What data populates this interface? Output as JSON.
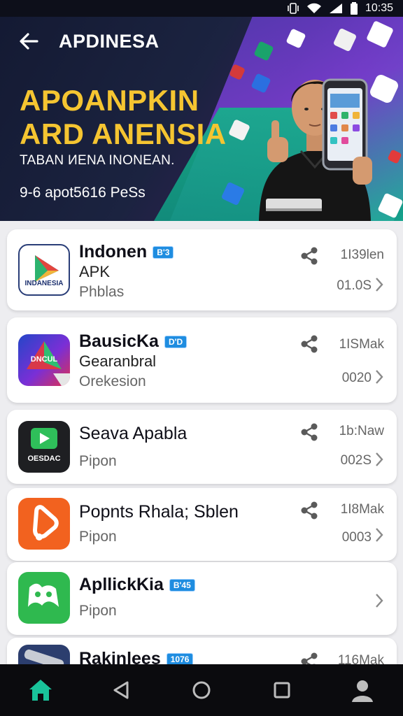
{
  "status": {
    "time": "10:35"
  },
  "header": {
    "title": "APDINESA"
  },
  "hero": {
    "headline_line1": "APOANPKIN",
    "headline_line2": "ARD ANENSIA",
    "subtitle": "TABAN ИENA INONEAN.",
    "meta": "9-6 apot5616 PeSs"
  },
  "apps": [
    {
      "name": "Indonen",
      "badge": "B'3",
      "line2": "APK",
      "line3": "Phblas",
      "size": "1I39len",
      "count": "01.0S",
      "icon_label": "INDANESIA",
      "icon_name": "play-triangle-icon"
    },
    {
      "name": "BausicKa",
      "badge": "D'D",
      "line2": "Gearanbral",
      "line3": "Orekesion",
      "size": "1ISMak",
      "count": "0020",
      "icon_label": "DNCUL",
      "icon_name": "gradient-diamond-icon"
    },
    {
      "name": "Seava Apabla",
      "badge": "",
      "line2": "",
      "line3": "Pipon",
      "size": "1b:Naw",
      "count": "002S",
      "icon_label": "OESDAC",
      "icon_name": "green-play-icon"
    },
    {
      "name": "Popnts Rhala; Sblen",
      "badge": "",
      "line2": "",
      "line3": "Pipon",
      "size": "1I8Mak",
      "count": "0003",
      "icon_label": "",
      "icon_name": "orange-bell-icon"
    },
    {
      "name": "ApllickKia",
      "badge": "B'45",
      "line2": "",
      "line3": "Pipon",
      "size": "",
      "count": "",
      "icon_label": "",
      "icon_name": "green-face-icon"
    },
    {
      "name": "Rakinlees",
      "badge": "1076",
      "line2": "",
      "line3": "",
      "size": "116Mak",
      "count": "",
      "icon_label": "",
      "icon_name": "tools-icon"
    }
  ],
  "colors": {
    "accent": "#f5c531",
    "badge": "#1f8de0",
    "nav_home": "#19c39a"
  }
}
